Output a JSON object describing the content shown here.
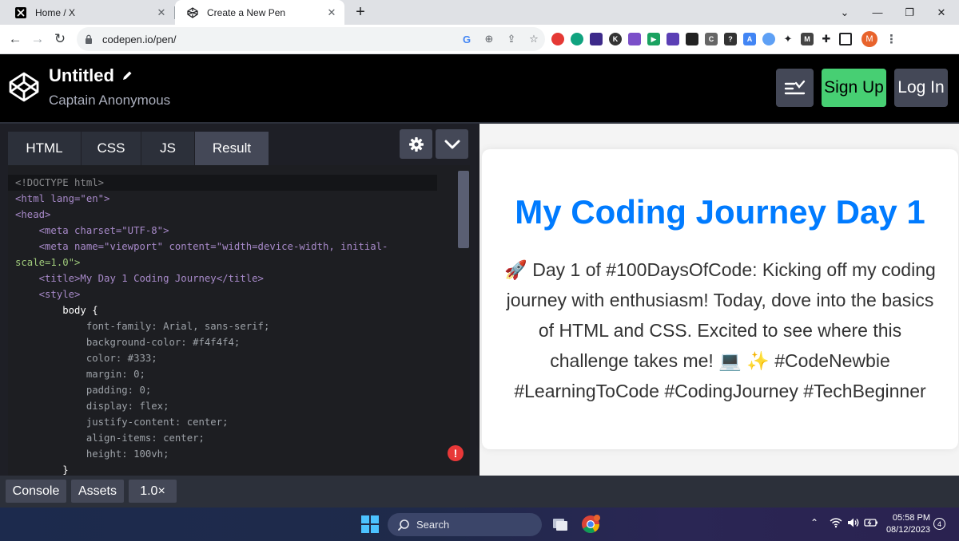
{
  "browser": {
    "tabs": [
      {
        "title": "Home / X",
        "active": false,
        "icon": "x-logo-icon"
      },
      {
        "title": "Create a New Pen",
        "active": true,
        "icon": "codepen-icon"
      }
    ],
    "url": "codepen.io/pen/",
    "profile_initial": "M"
  },
  "codepen": {
    "title": "Untitled",
    "author": "Captain Anonymous",
    "signup_label": "Sign Up",
    "login_label": "Log In"
  },
  "editor": {
    "tabs": [
      "HTML",
      "CSS",
      "JS",
      "Result"
    ],
    "code_lines": [
      "<!DOCTYPE html>",
      "<html lang=\"en\">",
      "<head>",
      "    <meta charset=\"UTF-8\">",
      "    <meta name=\"viewport\" content=\"width=device-width, initial-",
      "scale=1.0\">",
      "    <title>My Day 1 Coding Journey</title>",
      "    <style>",
      "        body {",
      "            font-family: Arial, sans-serif;",
      "            background-color: #f4f4f4;",
      "            color: #333;",
      "            margin: 0;",
      "            padding: 0;",
      "            display: flex;",
      "            justify-content: center;",
      "            align-items: center;",
      "            height: 100vh;",
      "        }"
    ]
  },
  "result": {
    "heading": "My Coding Journey Day 1",
    "body": "🚀 Day 1 of #100DaysOfCode: Kicking off my coding journey with enthusiasm! Today, dove into the basics of HTML and CSS. Excited to see where this challenge takes me! 💻 ✨ #CodeNewbie #LearningToCode #CodingJourney #TechBeginner"
  },
  "bottombar": {
    "console_label": "Console",
    "assets_label": "Assets",
    "zoom_label": "1.0×"
  },
  "taskbar": {
    "search_label": "Search",
    "time": "05:58 PM",
    "date": "08/12/2023",
    "notification_count": "4"
  },
  "colors": {
    "accent_green": "#47cf73",
    "heading_blue": "#007bff",
    "editor_bg": "#1d1e22",
    "button_gray": "#444857"
  }
}
